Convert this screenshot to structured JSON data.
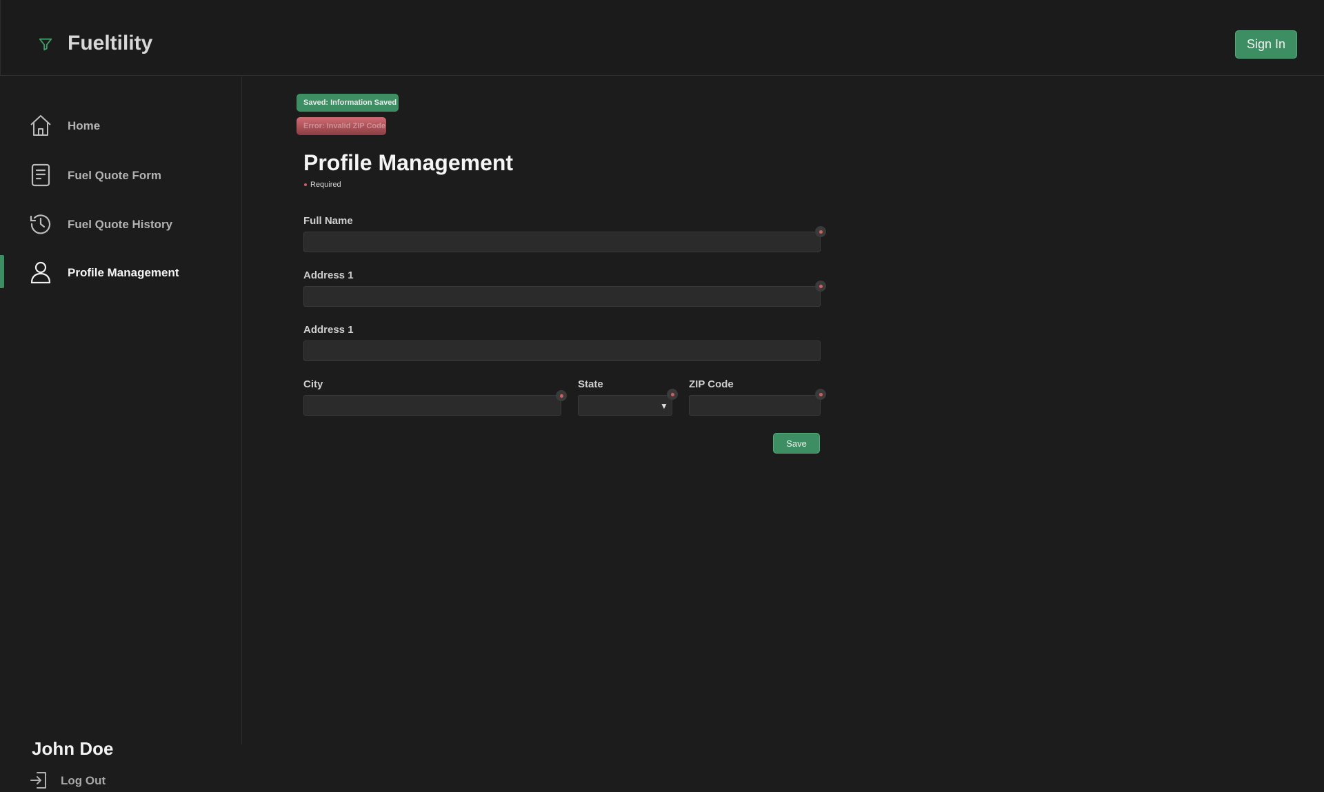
{
  "header": {
    "app_title": "Fueltility",
    "sign_in_label": "Sign In",
    "logo_icon": "funnel-icon"
  },
  "sidebar": {
    "items": [
      {
        "label": "Home",
        "icon": "home-icon"
      },
      {
        "label": "Fuel Quote Form",
        "icon": "form-icon"
      },
      {
        "label": "Fuel Quote History",
        "icon": "history-icon"
      },
      {
        "label": "Profile Management",
        "icon": "user-icon",
        "active": true
      }
    ],
    "user_name": "John Doe",
    "logout_label": "Log Out"
  },
  "toasts": {
    "success": "Saved: Information Saved",
    "error": "Error: Invalid ZIP Code"
  },
  "main": {
    "title": "Profile Management",
    "required_label": "Required",
    "fields": {
      "full_name": {
        "label": "Full Name",
        "value": ""
      },
      "address1": {
        "label": "Address 1",
        "value": ""
      },
      "address2": {
        "label": "Address 1",
        "value": ""
      },
      "city": {
        "label": "City",
        "value": ""
      },
      "state": {
        "label": "State",
        "value": ""
      },
      "zip": {
        "label": "ZIP Code",
        "value": ""
      }
    },
    "save_label": "Save"
  },
  "colors": {
    "accent": "#3e8e63",
    "error": "#c0585f",
    "background": "#1c1c1c"
  }
}
